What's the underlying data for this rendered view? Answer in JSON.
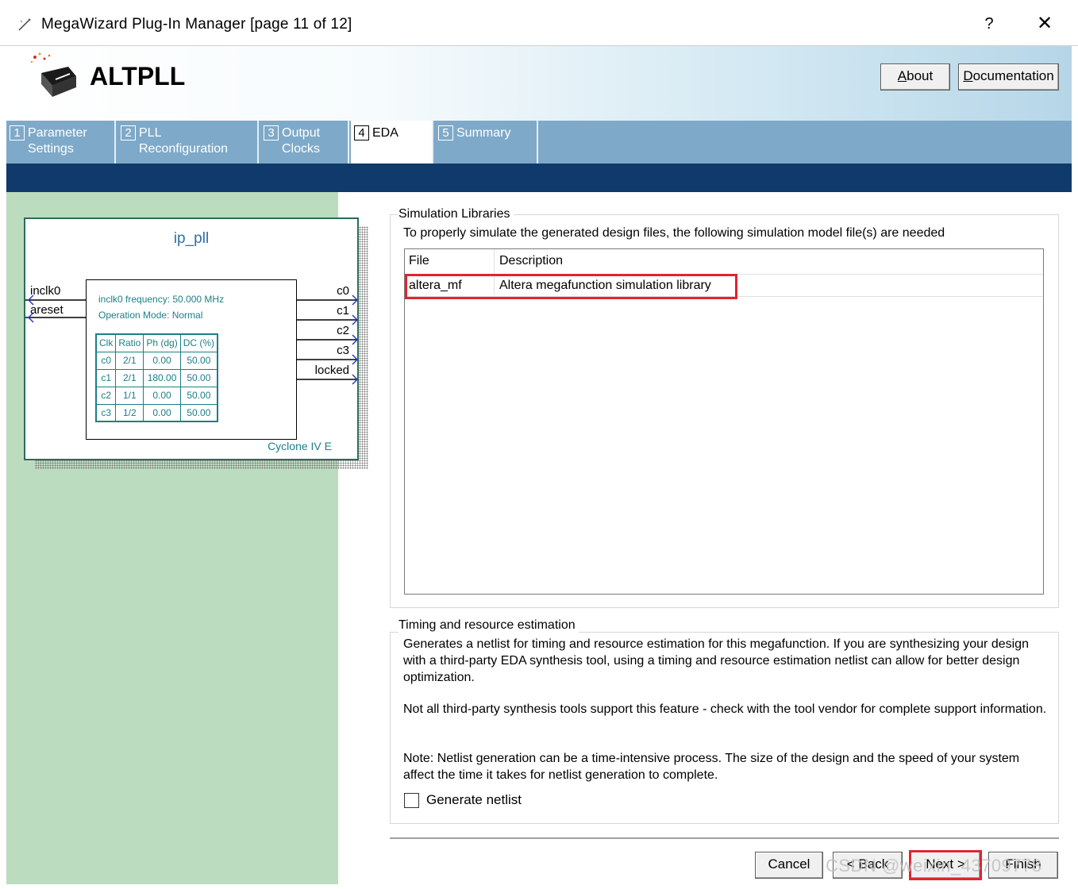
{
  "window": {
    "title": "MegaWizard Plug-In Manager [page 11 of 12]",
    "help_glyph": "?",
    "close_glyph": "✕"
  },
  "header": {
    "product": "ALTPLL",
    "about_label": "About",
    "about_underline": "A",
    "documentation_label": "Documentation",
    "documentation_underline": "D"
  },
  "tabs": [
    {
      "num": "1",
      "line1": "Parameter",
      "line2": "Settings"
    },
    {
      "num": "2",
      "line1": "PLL",
      "line2": "Reconfiguration"
    },
    {
      "num": "3",
      "line1": "Output",
      "line2": "Clocks"
    },
    {
      "num": "4",
      "line1": "EDA",
      "line2": ""
    },
    {
      "num": "5",
      "line1": "Summary",
      "line2": ""
    }
  ],
  "symbol": {
    "name": "ip_pll",
    "inputs": [
      "inclk0",
      "areset"
    ],
    "outputs": [
      "c0",
      "c1",
      "c2",
      "c3",
      "locked"
    ],
    "info_line1": "inclk0 frequency: 50.000 MHz",
    "info_line2": "Operation Mode: Normal",
    "table": {
      "headers": [
        "Clk",
        "Ratio",
        "Ph (dg)",
        "DC (%)"
      ],
      "rows": [
        [
          "c0",
          "2/1",
          "0.00",
          "50.00"
        ],
        [
          "c1",
          "2/1",
          "180.00",
          "50.00"
        ],
        [
          "c2",
          "1/1",
          "0.00",
          "50.00"
        ],
        [
          "c3",
          "1/2",
          "0.00",
          "50.00"
        ]
      ]
    },
    "family": "Cyclone IV E"
  },
  "simulation": {
    "group_title": "Simulation Libraries",
    "description": "To properly simulate the generated design files, the following simulation model file(s) are needed",
    "columns": [
      "File",
      "Description"
    ],
    "rows": [
      {
        "file": "altera_mf",
        "description": "Altera megafunction simulation library"
      }
    ]
  },
  "timing": {
    "group_title": "Timing and resource estimation",
    "para1": "Generates a netlist for timing and resource estimation for this megafunction. If you are synthesizing your design with a third-party EDA synthesis tool, using a timing and resource estimation netlist can allow for better design optimization.",
    "para2": "Not all third-party synthesis tools support this feature - check with the tool vendor for complete support information.",
    "para3": "Note: Netlist generation can be a time-intensive process. The size of the design and the speed of your system affect the time it takes for netlist generation to complete.",
    "checkbox_label": "Generate netlist",
    "checkbox_checked": false
  },
  "footer": {
    "cancel_label": "Cancel",
    "back_label": "< Back",
    "next_label": "Next >",
    "finish_label": "Finish"
  },
  "watermark": "CSDN @weixin_43709778",
  "colors": {
    "tab_bar": "#7fa9c8",
    "sub_bar": "#0f3a6b",
    "left_panel": "#bcdcbf",
    "highlight": "#e0252f",
    "symbol_text": "#1c7f86"
  }
}
